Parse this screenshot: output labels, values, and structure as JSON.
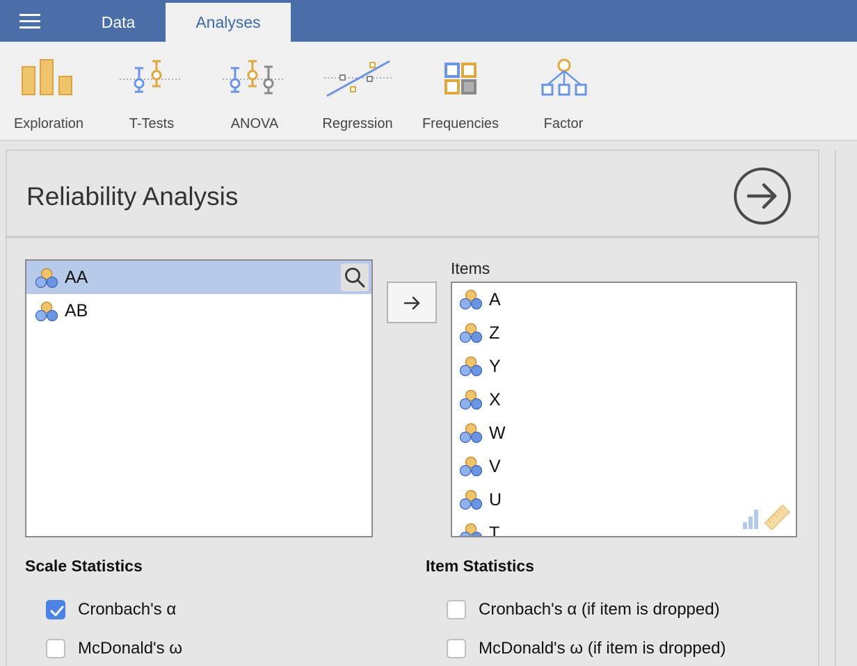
{
  "menu": {
    "icon": "hamburger-menu-icon"
  },
  "tabs": {
    "data": "Data",
    "analyses": "Analyses"
  },
  "ribbon": [
    {
      "label": "Exploration",
      "icon": "exploration-icon"
    },
    {
      "label": "T-Tests",
      "icon": "t-tests-icon"
    },
    {
      "label": "ANOVA",
      "icon": "anova-icon"
    },
    {
      "label": "Regression",
      "icon": "regression-icon"
    },
    {
      "label": "Frequencies",
      "icon": "frequencies-icon"
    },
    {
      "label": "Factor",
      "icon": "factor-icon"
    }
  ],
  "panel": {
    "title": "Reliability Analysis",
    "available_variables": [
      "AA",
      "AB"
    ],
    "selected_variable": "AA",
    "items_label": "Items",
    "items": [
      "A",
      "Z",
      "Y",
      "X",
      "W",
      "V",
      "U",
      "T"
    ]
  },
  "scale_statistics": {
    "title": "Scale Statistics",
    "options": [
      {
        "label": "Cronbach's α",
        "checked": true
      },
      {
        "label": "McDonald's ω",
        "checked": false
      }
    ]
  },
  "item_statistics": {
    "title": "Item Statistics",
    "options": [
      {
        "label": "Cronbach's α (if item is dropped)",
        "checked": false
      },
      {
        "label": "McDonald's ω (if item is dropped)",
        "checked": false
      }
    ]
  },
  "colors": {
    "topbar": "#4a6ea8",
    "accent": "#3e69a6",
    "selected_row": "#b8caea",
    "checkbox": "#4c84e6",
    "icon_orange": "#e6b45c",
    "icon_blue": "#6b95e0"
  }
}
